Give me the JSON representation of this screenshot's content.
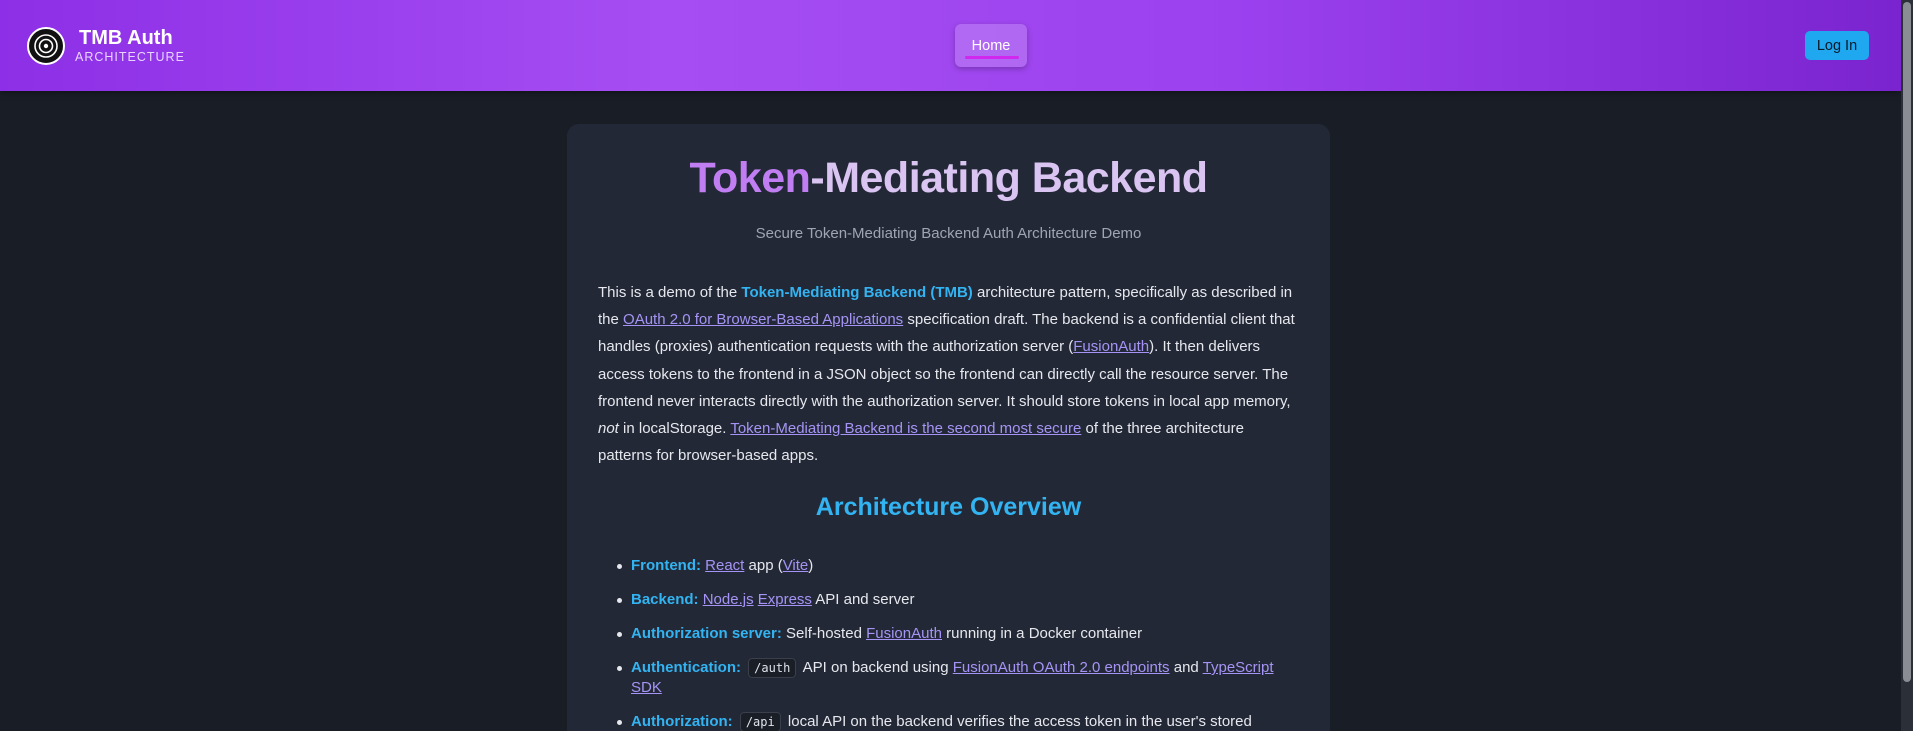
{
  "header": {
    "brand_title": "TMB Auth",
    "brand_subtitle": "ARCHITECTURE",
    "logo_icon": "target-logo-icon",
    "nav": [
      {
        "label": "Home",
        "active": true
      }
    ],
    "login_label": "Log In",
    "colors": {
      "gradient_start": "#8d2fe6",
      "gradient_end": "#7a24cf",
      "login_bg": "#1fa7ef"
    }
  },
  "card": {
    "title_part1": "Token",
    "title_part2": "-Mediating Backend",
    "subtitle": "Secure Token-Mediating Backend Auth Architecture Demo",
    "intro": {
      "p1": "This is a demo of the ",
      "tmb_strong": "Token-Mediating Backend (TMB)",
      "p2": " architecture pattern, specifically as described in the ",
      "link_oauth": "OAuth 2.0 for Browser-Based Applications",
      "p3": " specification draft. The backend is a confidential client that handles (proxies) authentication requests with the authorization server (",
      "link_fusionauth": "FusionAuth",
      "p4": "). It then delivers access tokens to the frontend in a JSON object so the frontend can directly call the resource server. The frontend never interacts directly with the authorization server. It should store tokens in local app memory, ",
      "em_not": "not",
      "p5": " in localStorage. ",
      "link_secure": "Token-Mediating Backend is the second most secure",
      "p6": " of the three architecture patterns for browser-based apps."
    },
    "section_title": "Architecture Overview",
    "features": {
      "frontend": {
        "label": "Frontend:",
        "link1": "React",
        "t1": " app (",
        "link2": "Vite",
        "t2": ")"
      },
      "backend": {
        "label": "Backend:",
        "link1": "Node.js",
        "link2": "Express",
        "t1": " API and server"
      },
      "authz_server": {
        "label": "Authorization server:",
        "t1": " Self-hosted ",
        "link1": "FusionAuth",
        "t2": " running in a Docker container"
      },
      "authentication": {
        "label": "Authentication:",
        "code": "/auth",
        "t1": " API on backend using ",
        "link1": "FusionAuth OAuth 2.0 endpoints",
        "t2": " and ",
        "link2": "TypeScript SDK"
      },
      "authorization": {
        "label": "Authorization:",
        "code": "/api",
        "t1": " local API on the backend verifies the access token in the user's stored session before allowing access to protected resources"
      }
    }
  }
}
